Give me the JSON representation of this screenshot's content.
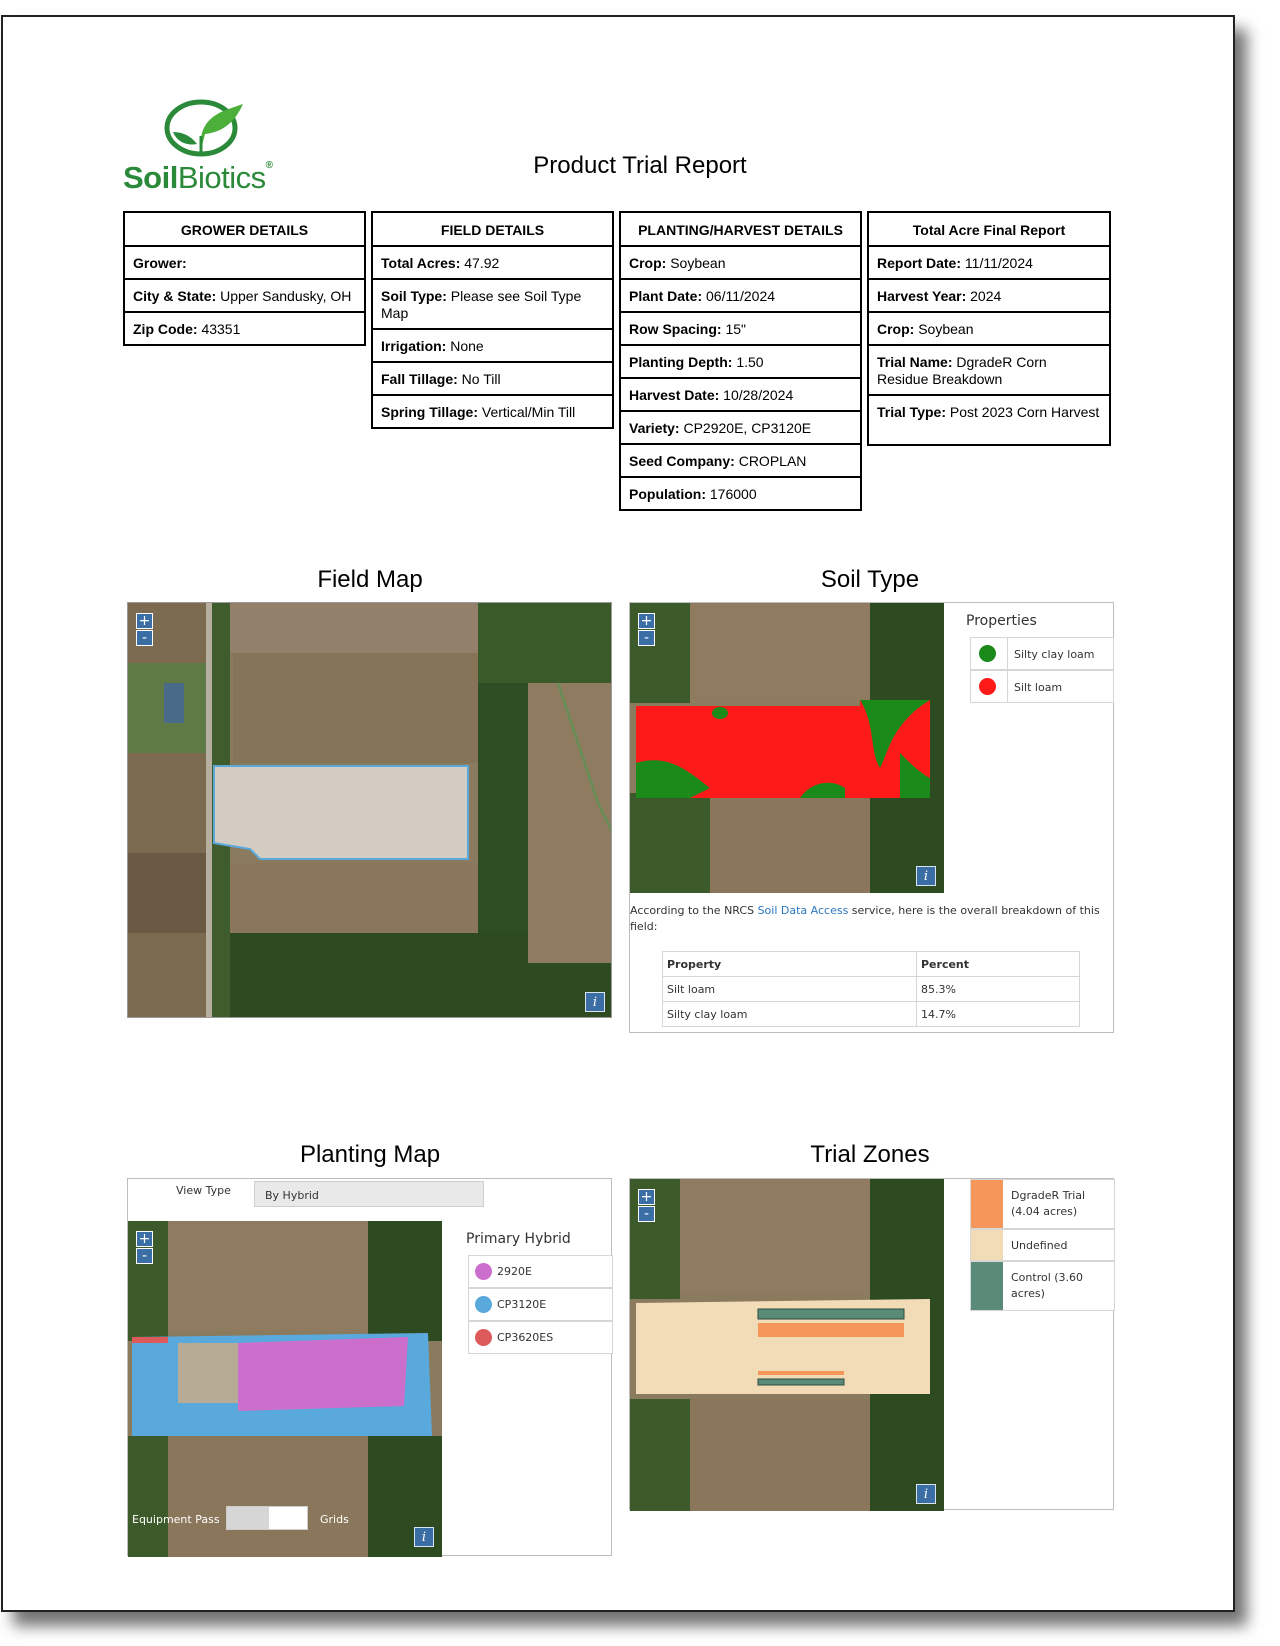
{
  "brand": {
    "name_bold": "Soil",
    "name_light": "Biotics",
    "reg_mark": "®",
    "green": "#2b8a3a"
  },
  "report": {
    "title": "Product Trial Report"
  },
  "grower_details": {
    "header": "GROWER DETAILS",
    "rows": [
      {
        "label": "Grower:",
        "value": ""
      },
      {
        "label": "City & State:",
        "value": "Upper Sandusky, OH"
      },
      {
        "label": "Zip Code:",
        "value": "43351"
      }
    ]
  },
  "field_details": {
    "header": "FIELD DETAILS",
    "rows": [
      {
        "label": "Total Acres:",
        "value": "47.92"
      },
      {
        "label": "Soil Type:",
        "value": "Please see Soil Type Map"
      },
      {
        "label": "Irrigation:",
        "value": "None"
      },
      {
        "label": "Fall Tillage:",
        "value": "No Till"
      },
      {
        "label": "Spring Tillage:",
        "value": "Vertical/Min Till"
      }
    ]
  },
  "planting_details": {
    "header": "PLANTING/HARVEST DETAILS",
    "rows": [
      {
        "label": "Crop:",
        "value": "Soybean"
      },
      {
        "label": "Plant Date:",
        "value": "06/11/2024"
      },
      {
        "label": "Row Spacing:",
        "value": "15\""
      },
      {
        "label": "Planting Depth:",
        "value": "1.50"
      },
      {
        "label": "Harvest Date:",
        "value": "10/28/2024"
      },
      {
        "label": "Variety:",
        "value": " CP2920E, CP3120E"
      },
      {
        "label": "Seed Company:",
        "value": " CROPLAN"
      },
      {
        "label": "Population:",
        "value": " 176000"
      }
    ]
  },
  "acre_report": {
    "header": "Total Acre Final Report",
    "rows": [
      {
        "label": "Report Date:",
        "value": "11/11/2024"
      },
      {
        "label": "Harvest Year:",
        "value": "2024"
      },
      {
        "label": "Crop:",
        "value": "Soybean"
      },
      {
        "label": "Trial Name:",
        "value": "DgradeR Corn Residue Breakdown"
      },
      {
        "label": "Trial Type:",
        "value": "Post 2023 Corn Harvest"
      }
    ]
  },
  "field_map": {
    "title": "Field Map",
    "zoom_in": "+",
    "zoom_out": "-",
    "info": "i"
  },
  "soil_type": {
    "title": "Soil Type",
    "legend_title": "Properties",
    "legend": [
      {
        "label": "Silty clay loam",
        "color": "#1a8a1a"
      },
      {
        "label": "Silt loam",
        "color": "#ff1a1a"
      }
    ],
    "note_prefix": "According to the NRCS ",
    "note_link": "Soil Data Access",
    "note_suffix": " service, here is the overall breakdown of this field:",
    "table_headers": [
      "Property",
      "Percent"
    ],
    "table_rows": [
      {
        "property": "Silt loam",
        "percent": "85.3%"
      },
      {
        "property": "Silty clay loam",
        "percent": "14.7%"
      }
    ]
  },
  "planting_map": {
    "title": "Planting Map",
    "view_type_label": "View Type",
    "view_type_value": "By Hybrid",
    "legend_title": "Primary Hybrid",
    "legend": [
      {
        "label": "2920E",
        "color": "#cc6fcc"
      },
      {
        "label": "CP3120E",
        "color": "#5aa9dd"
      },
      {
        "label": "CP3620ES",
        "color": "#dd5a5a"
      }
    ],
    "equipment_pass_label": "Equipment Pass",
    "grids_label": "Grids"
  },
  "trial_zones": {
    "title": "Trial Zones",
    "legend": [
      {
        "label": "DgradeR Trial (4.04 acres)",
        "color": "#f5975a"
      },
      {
        "label": "Undefined",
        "color": "#f2dcb8"
      },
      {
        "label": "Control (3.60 acres)",
        "color": "#5a8a78"
      }
    ]
  }
}
